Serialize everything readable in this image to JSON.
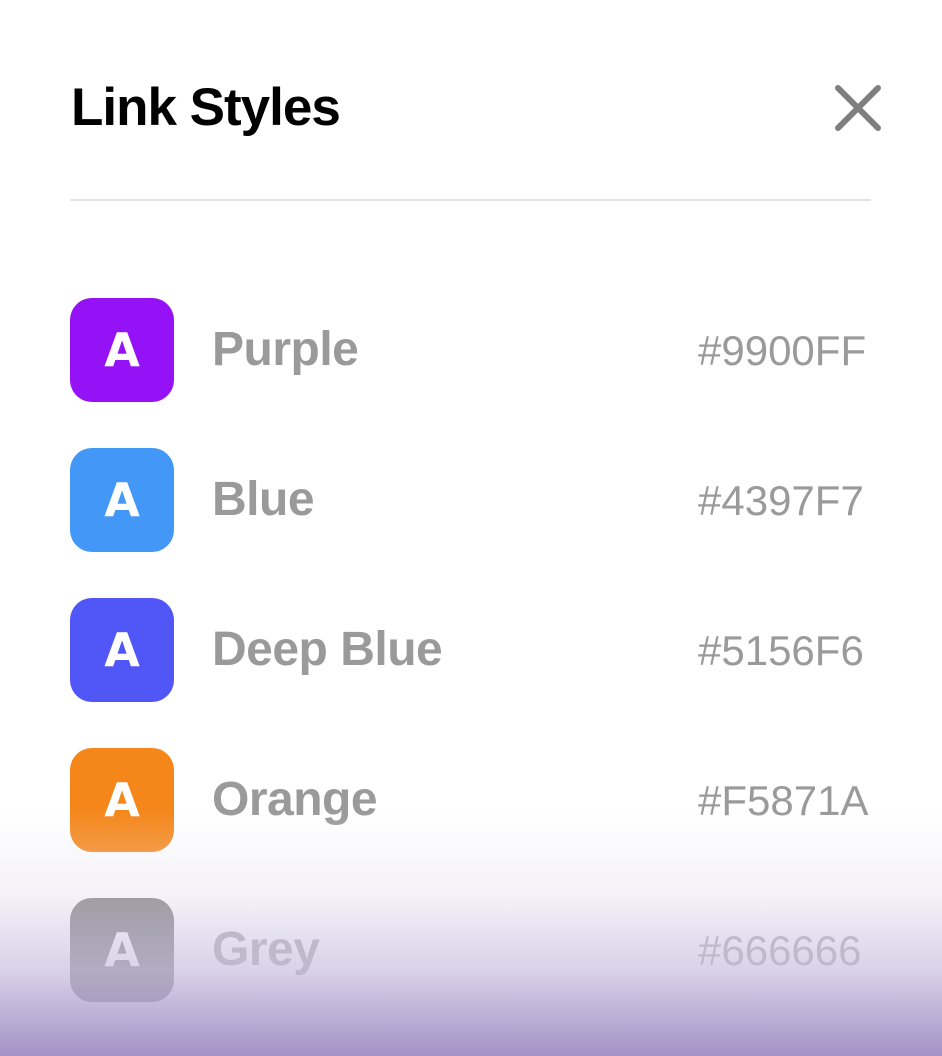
{
  "header": {
    "title": "Link Styles"
  },
  "close": {
    "icon": "close-icon"
  },
  "styles": [
    {
      "letter": "A",
      "label": "Purple",
      "hex": "#9900FF",
      "color": "#9412F5"
    },
    {
      "letter": "A",
      "label": "Blue",
      "hex": "#4397F7",
      "color": "#4397F7"
    },
    {
      "letter": "A",
      "label": "Deep Blue",
      "hex": "#5156F6",
      "color": "#5156F6"
    },
    {
      "letter": "A",
      "label": "Orange",
      "hex": "#F5871A",
      "color": "#F5871A"
    },
    {
      "letter": "A",
      "label": "Grey",
      "hex": "#666666",
      "color": "#666666"
    }
  ]
}
